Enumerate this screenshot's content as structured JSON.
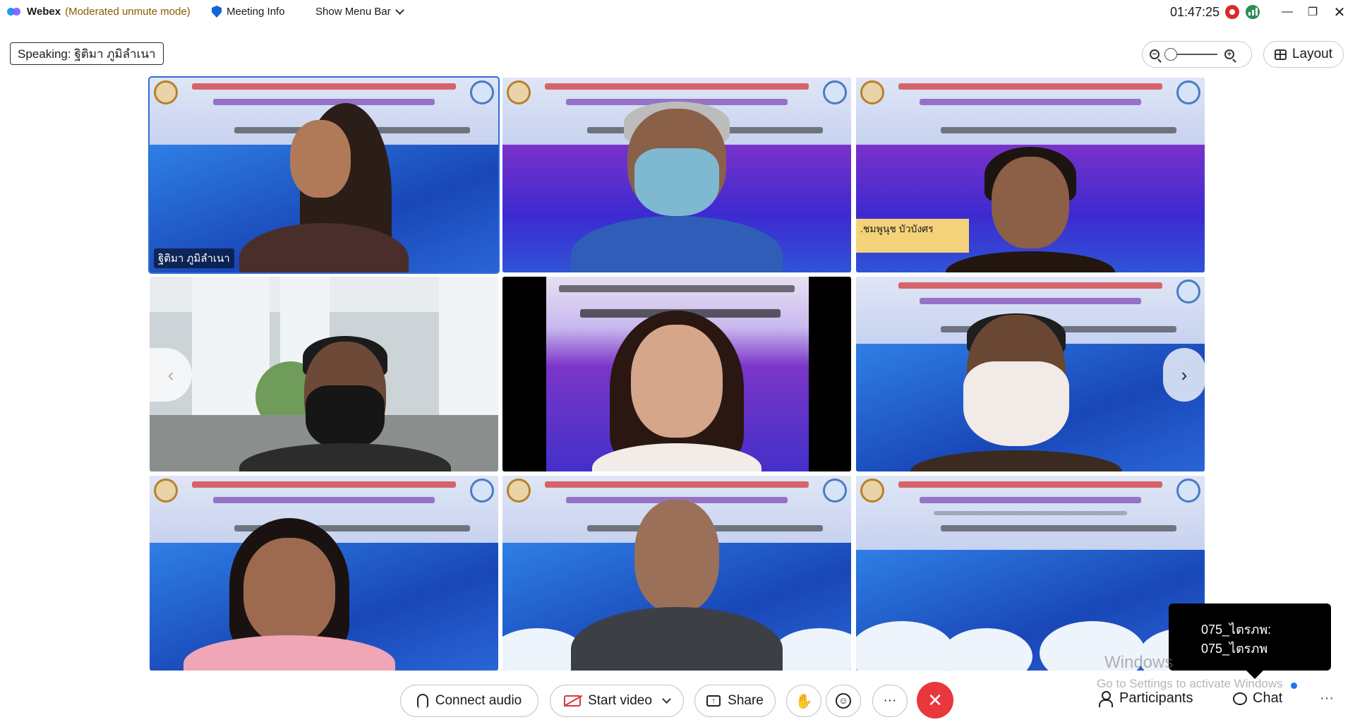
{
  "titlebar": {
    "app_name": "Webex",
    "mode": "(Moderated unmute mode)",
    "meeting_info": "Meeting Info",
    "show_menu": "Show Menu Bar",
    "clock": "01:47:25"
  },
  "speaking": "Speaking: ฐิติมา ภูมิลำเนา",
  "layout_label": "Layout",
  "participants": [
    {
      "name": "ฐิติมา ภูมิลำเนา"
    },
    {
      "caption": ".ชมพูนุช บัวบังศร"
    }
  ],
  "tooltip": {
    "line1": "075_ไตรภพ:",
    "line2": "075_ไตรภพ"
  },
  "watermark": {
    "title": "Windows",
    "subtitle": "Go to Settings to activate Windows"
  },
  "controls": {
    "connect_audio": "Connect audio",
    "start_video": "Start video",
    "share": "Share",
    "more": "···",
    "leave": "✕",
    "participants": "Participants",
    "chat": "Chat",
    "overflow": "···"
  }
}
